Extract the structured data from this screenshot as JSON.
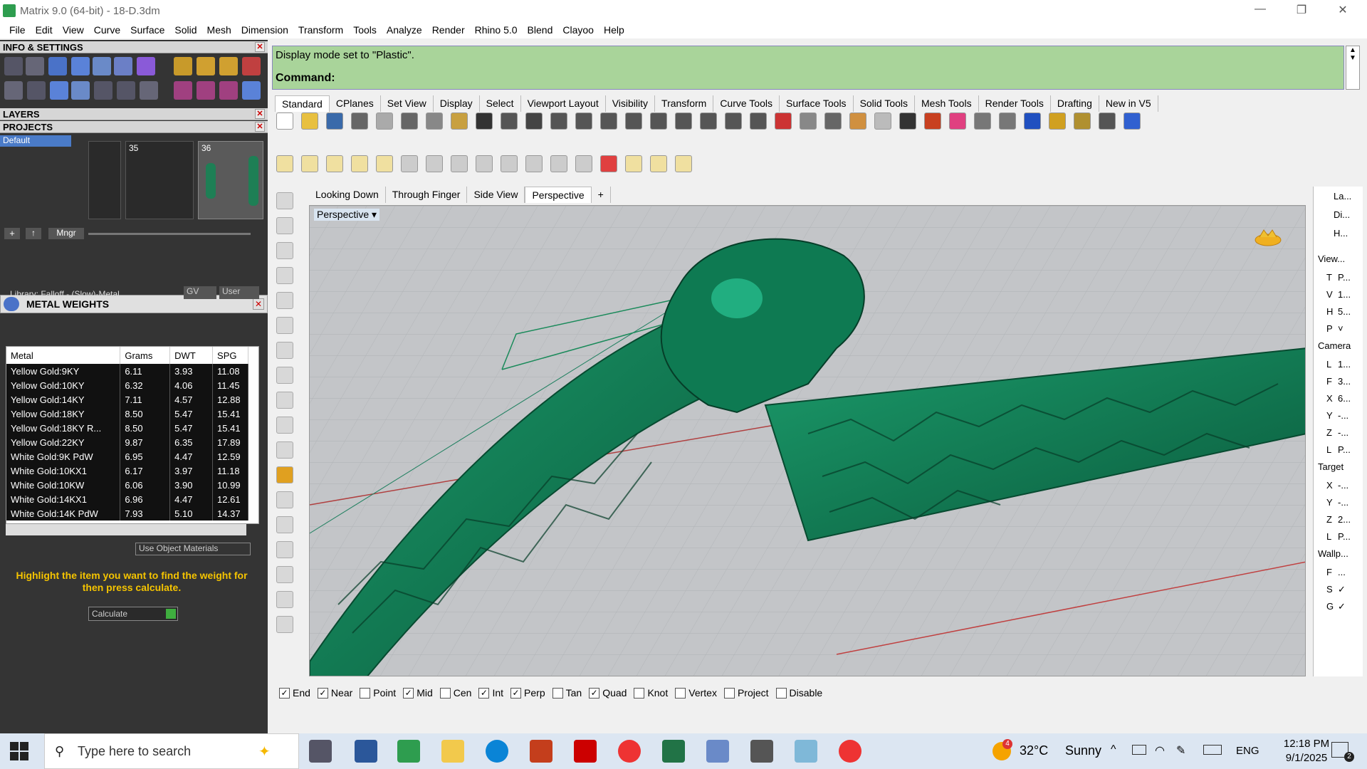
{
  "window": {
    "title": "Matrix 9.0 (64-bit) - 18-D.3dm",
    "minimize": "—",
    "maximize": "❐",
    "close": "✕"
  },
  "menu": [
    "File",
    "Edit",
    "View",
    "Curve",
    "Surface",
    "Solid",
    "Mesh",
    "Dimension",
    "Transform",
    "Tools",
    "Analyze",
    "Render",
    "Rhino 5.0",
    "Blend",
    "Clayoo",
    "Help"
  ],
  "panels": {
    "info": "INFO & SETTINGS",
    "layers": "LAYERS",
    "projects": "PROJECTS",
    "project_default": "Default",
    "project_35": "35",
    "project_36": "36",
    "mngr": "Mngr"
  },
  "metal_weights": {
    "title": "METAL WEIGHTS",
    "library": "Library: Falloff - (Slow)-Metal",
    "gv": "GV",
    "user": "User",
    "columns": [
      "Metal",
      "Grams",
      "DWT",
      "SPG"
    ],
    "rows": [
      [
        "Yellow Gold:9KY",
        "6.11",
        "3.93",
        "11.08"
      ],
      [
        "Yellow Gold:10KY",
        "6.32",
        "4.06",
        "11.45"
      ],
      [
        "Yellow Gold:14KY",
        "7.11",
        "4.57",
        "12.88"
      ],
      [
        "Yellow Gold:18KY",
        "8.50",
        "5.47",
        "15.41"
      ],
      [
        "Yellow Gold:18KY R...",
        "8.50",
        "5.47",
        "15.41"
      ],
      [
        "Yellow Gold:22KY",
        "9.87",
        "6.35",
        "17.89"
      ],
      [
        "White Gold:9K PdW",
        "6.95",
        "4.47",
        "12.59"
      ],
      [
        "White Gold:10KX1",
        "6.17",
        "3.97",
        "11.18"
      ],
      [
        "White Gold:10KW",
        "6.06",
        "3.90",
        "10.99"
      ],
      [
        "White Gold:14KX1",
        "6.96",
        "4.47",
        "12.61"
      ],
      [
        "White Gold:14K PdW",
        "7.93",
        "5.10",
        "14.37"
      ]
    ],
    "use_object_materials": "Use Object Materials",
    "hint": "Highlight the item you want to find the weight for then press calculate.",
    "calculate": "Calculate"
  },
  "command": {
    "history": "Display mode set to \"Plastic\".",
    "prompt": "Command:"
  },
  "toolbar_tabs": [
    "Standard",
    "CPlanes",
    "Set View",
    "Display",
    "Select",
    "Viewport Layout",
    "Visibility",
    "Transform",
    "Curve Tools",
    "Surface Tools",
    "Solid Tools",
    "Mesh Tools",
    "Render Tools",
    "Drafting",
    "New in V5"
  ],
  "viewport_tabs": [
    "Looking Down",
    "Through Finger",
    "Side View",
    "Perspective",
    "+"
  ],
  "viewport": {
    "label": "Perspective",
    "dropdown": "▾"
  },
  "right_panel": {
    "tabs": [
      "La...",
      "Di...",
      "H..."
    ],
    "view_heading": "View...",
    "view_rows": [
      [
        "T",
        "P..."
      ],
      [
        "V",
        "1..."
      ],
      [
        "H",
        "5..."
      ],
      [
        "P",
        "˅"
      ]
    ],
    "camera_heading": "Camera",
    "camera_rows": [
      [
        "L",
        "1..."
      ],
      [
        "F",
        "3..."
      ],
      [
        "X",
        "6..."
      ],
      [
        "Y",
        "-..."
      ],
      [
        "Z",
        "-..."
      ],
      [
        "L",
        "P..."
      ]
    ],
    "target_heading": "Target",
    "target_rows": [
      [
        "X",
        "-..."
      ],
      [
        "Y",
        "-..."
      ],
      [
        "Z",
        "2..."
      ],
      [
        "L",
        "P..."
      ]
    ],
    "wallpaper_heading": "Wallp...",
    "wallpaper_rows": [
      [
        "F",
        "..."
      ],
      [
        "S",
        "✓"
      ],
      [
        "G",
        "✓"
      ]
    ]
  },
  "osnaps": [
    {
      "label": "End",
      "checked": true
    },
    {
      "label": "Near",
      "checked": true
    },
    {
      "label": "Point",
      "checked": false
    },
    {
      "label": "Mid",
      "checked": true
    },
    {
      "label": "Cen",
      "checked": false
    },
    {
      "label": "Int",
      "checked": true
    },
    {
      "label": "Perp",
      "checked": true
    },
    {
      "label": "Tan",
      "checked": false
    },
    {
      "label": "Quad",
      "checked": true
    },
    {
      "label": "Knot",
      "checked": false
    },
    {
      "label": "Vertex",
      "checked": false
    },
    {
      "label": "Project",
      "checked": false
    },
    {
      "label": "Disable",
      "checked": false
    }
  ],
  "taskbar": {
    "search_placeholder": "Type here to search",
    "weather_temp": "32°C",
    "weather_desc": "Sunny",
    "weather_badge": "4",
    "lang": "ENG",
    "time": "12:18 PM",
    "date": "9/1/2025",
    "notification_count": "2"
  },
  "colors": {
    "model": "#0f7a55",
    "command_bg": "#a9d49a",
    "panel_dark": "#343434",
    "hint_text": "#f5c400",
    "taskbar": "#dce6f2"
  }
}
